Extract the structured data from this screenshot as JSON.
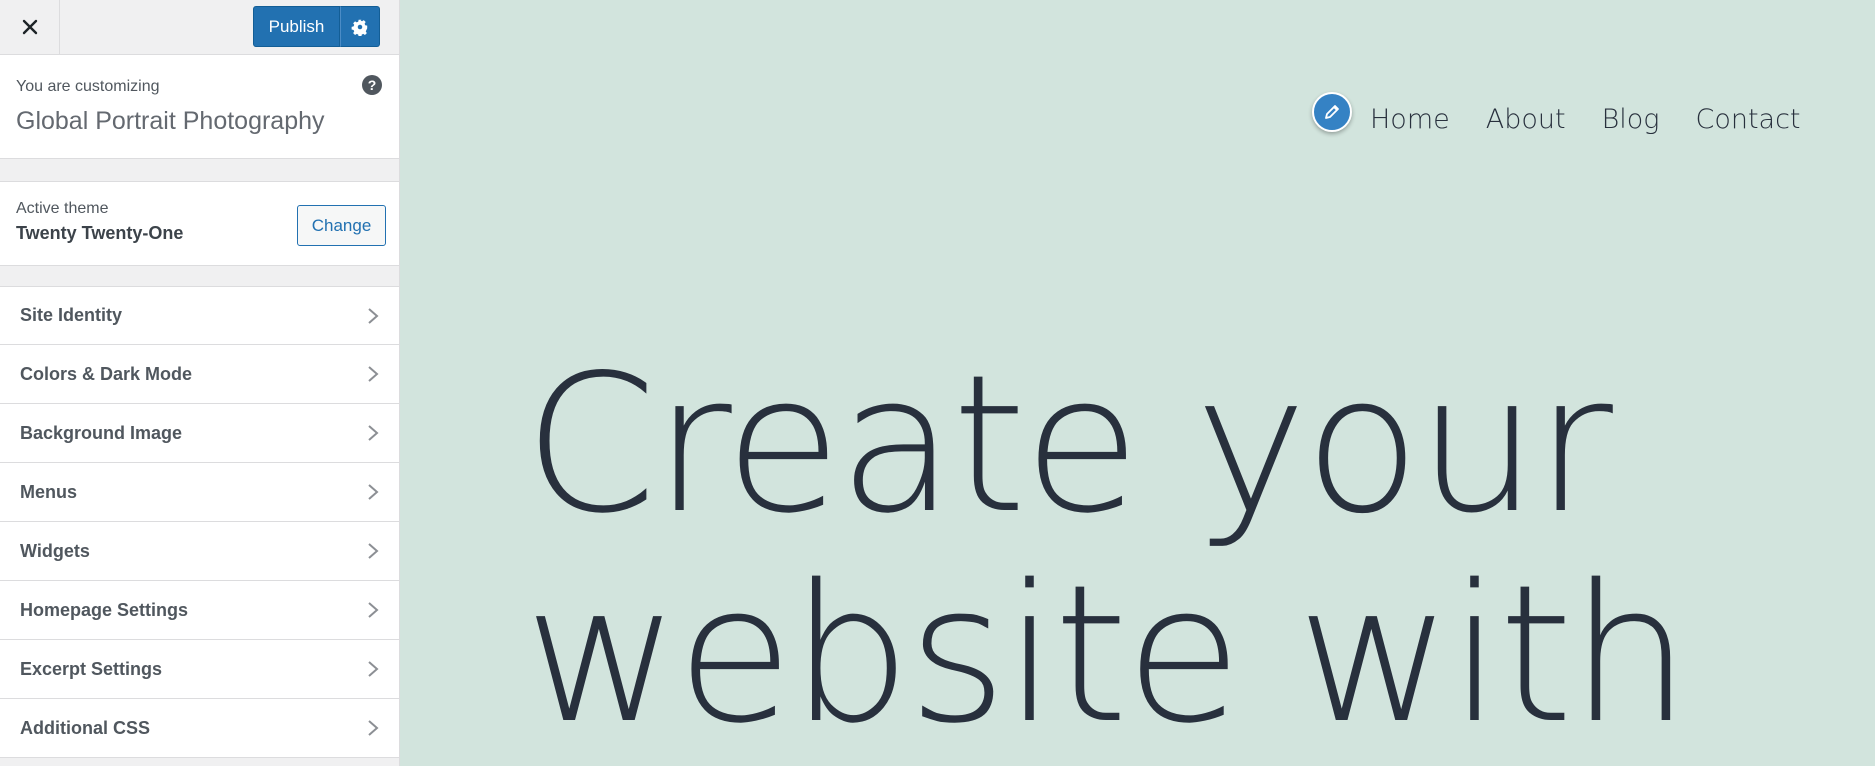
{
  "topbar": {
    "close_icon": "close-icon",
    "publish_label": "Publish",
    "settings_icon": "gear-icon"
  },
  "customizing": {
    "label": "You are customizing",
    "site_title": "Global Portrait Photography",
    "help_icon": "?"
  },
  "theme": {
    "label": "Active theme",
    "name": "Twenty Twenty-One",
    "change_label": "Change"
  },
  "sections": [
    {
      "label": "Site Identity"
    },
    {
      "label": "Colors & Dark Mode"
    },
    {
      "label": "Background Image"
    },
    {
      "label": "Menus"
    },
    {
      "label": "Widgets"
    },
    {
      "label": "Homepage Settings"
    },
    {
      "label": "Excerpt Settings"
    },
    {
      "label": "Additional CSS"
    }
  ],
  "preview": {
    "nav": [
      "Home",
      "About",
      "Blog",
      "Contact"
    ],
    "hero_line1": "Create your",
    "hero_line2": "website with",
    "edit_icon": "pencil-icon"
  },
  "colors": {
    "accent": "#2271b1",
    "preview_bg": "#d2e4dd",
    "text_dark": "#28303d"
  }
}
